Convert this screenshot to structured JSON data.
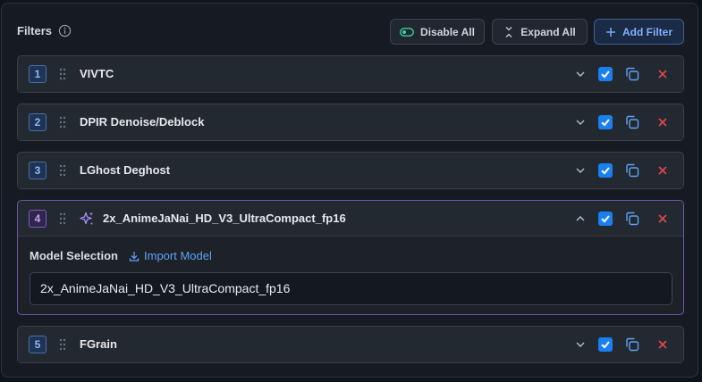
{
  "header": {
    "title": "Filters",
    "disable_all": "Disable All",
    "expand_all": "Expand All",
    "add_filter": "Add Filter"
  },
  "filters": [
    {
      "index": "1",
      "name": "VIVTC",
      "enabled": true,
      "expanded": false
    },
    {
      "index": "2",
      "name": "DPIR Denoise/Deblock",
      "enabled": true,
      "expanded": false
    },
    {
      "index": "3",
      "name": "LGhost Deghost",
      "enabled": true,
      "expanded": false
    },
    {
      "index": "4",
      "name": "2x_AnimeJaNai_HD_V3_UltraCompact_fp16",
      "enabled": true,
      "expanded": true,
      "icon": "sparkle-icon",
      "model_selection_label": "Model Selection",
      "import_model_label": "Import Model",
      "model_value": "2x_AnimeJaNai_HD_V3_UltraCompact_fp16"
    },
    {
      "index": "5",
      "name": "FGrain",
      "enabled": true,
      "expanded": false
    }
  ],
  "colors": {
    "accent": "#1a7ff0",
    "delete": "#e5484d",
    "selected_border": "#6f56a8",
    "link": "#5ea2f5"
  }
}
